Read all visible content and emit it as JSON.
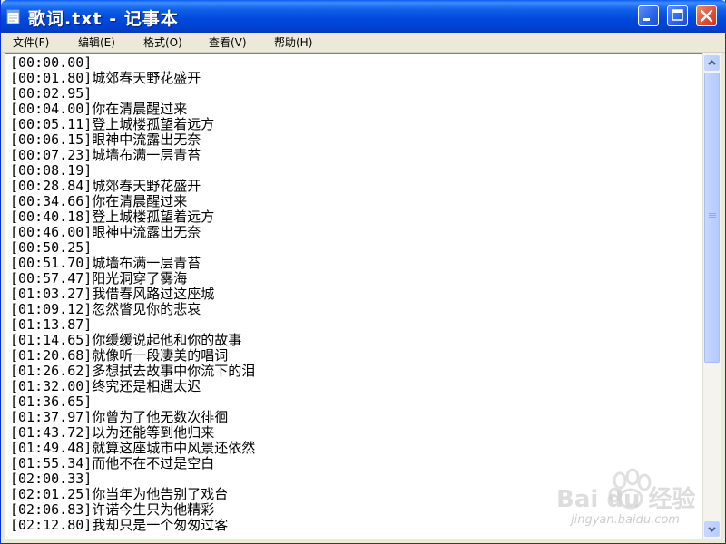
{
  "window": {
    "title": "歌词.txt - 记事本"
  },
  "menu": [
    "文件(F)",
    "编辑(E)",
    "格式(O)",
    "查看(V)",
    "帮助(H)"
  ],
  "lines": [
    "[00:00.00]",
    "[00:01.80]城郊春天野花盛开",
    "[00:02.95]",
    "[00:04.00]你在清晨醒过来",
    "[00:05.11]登上城楼孤望着远方",
    "[00:06.15]眼神中流露出无奈",
    "[00:07.23]城墙布满一层青苔",
    "[00:08.19]",
    "[00:28.84]城郊春天野花盛开",
    "[00:34.66]你在清晨醒过来",
    "[00:40.18]登上城楼孤望着远方",
    "[00:46.00]眼神中流露出无奈",
    "[00:50.25]",
    "[00:51.70]城墙布满一层青苔",
    "[00:57.47]阳光洞穿了雾海",
    "[01:03.27]我借春风路过这座城",
    "[01:09.12]忽然瞥见你的悲哀",
    "[01:13.87]",
    "[01:14.65]你缓缓说起他和你的故事",
    "[01:20.68]就像听一段凄美的唱词",
    "[01:26.62]多想拭去故事中你流下的泪",
    "[01:32.00]终究还是相遇太迟",
    "[01:36.65]",
    "[01:37.97]你曾为了他无数次徘徊",
    "[01:43.72]以为还能等到他归来",
    "[01:49.48]就算这座城市中风景还依然",
    "[01:55.34]而他不在不过是空白",
    "[02:00.33]",
    "[02:01.25]你当年为他告别了戏台",
    "[02:06.83]许诺今生只为他精彩",
    "[02:12.80]我却只是一个匆匆过客"
  ],
  "watermark": {
    "logo": "Bai du 经验",
    "url": "jingyan.baidu.com"
  }
}
